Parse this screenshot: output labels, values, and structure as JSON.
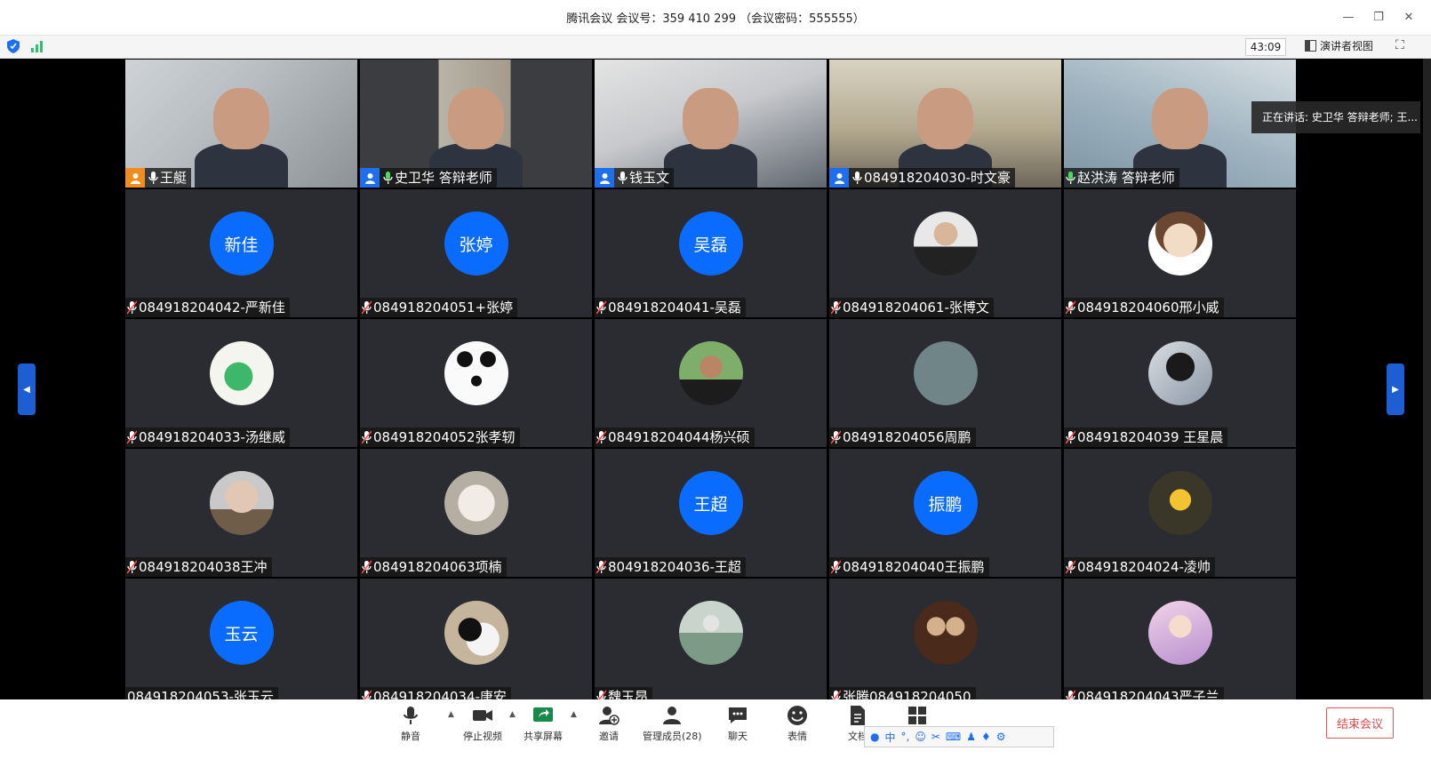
{
  "window": {
    "title": "腾讯会议 会议号：359 410 299 （会议密码：555555）",
    "controls": [
      "—",
      "❐",
      "✕"
    ]
  },
  "status": {
    "timer": "43:09",
    "presenter_view": "演讲者视图"
  },
  "speaking_tooltip": "正在讲话: 史卫华 答辩老师; 王...",
  "tiles": [
    {
      "name": "王艇",
      "kind": "video",
      "scene": "s1",
      "icon": "orange",
      "mic": "on"
    },
    {
      "name": "史卫华 答辩老师",
      "kind": "video",
      "scene": "s2",
      "icon": "blue",
      "mic": "speaking",
      "active": true
    },
    {
      "name": "钱玉文",
      "kind": "video",
      "scene": "s3",
      "icon": "blue",
      "mic": "on"
    },
    {
      "name": "084918204030-时文豪",
      "kind": "video",
      "scene": "s4",
      "icon": "blue",
      "mic": "on"
    },
    {
      "name": "赵洪涛 答辩老师",
      "kind": "video",
      "scene": "s5",
      "icon": "none",
      "mic": "speaking"
    },
    {
      "name": "084918204042-严新佳",
      "kind": "avatar",
      "initials": "新佳",
      "mic": "muted"
    },
    {
      "name": "084918204051+张婷",
      "kind": "avatar",
      "initials": "张婷",
      "mic": "muted"
    },
    {
      "name": "084918204041-吴磊",
      "kind": "avatar",
      "initials": "吴磊",
      "mic": "muted"
    },
    {
      "name": "084918204061-张博文",
      "kind": "photo",
      "photo": "p1",
      "mic": "muted"
    },
    {
      "name": "084918204060邢小威",
      "kind": "photo",
      "photo": "p2",
      "mic": "muted"
    },
    {
      "name": "084918204033-汤继威",
      "kind": "photo",
      "photo": "p3",
      "mic": "muted"
    },
    {
      "name": "084918204052张孝轫",
      "kind": "photo",
      "photo": "p4",
      "mic": "muted"
    },
    {
      "name": "084918204044杨兴硕",
      "kind": "photo",
      "photo": "p5",
      "mic": "muted"
    },
    {
      "name": "084918204056周鹏",
      "kind": "photo",
      "photo": "p6",
      "mic": "muted"
    },
    {
      "name": "084918204039 王星晨",
      "kind": "photo",
      "photo": "p7",
      "mic": "muted"
    },
    {
      "name": "084918204038王冲",
      "kind": "photo",
      "photo": "p8",
      "mic": "muted"
    },
    {
      "name": "084918204063项楠",
      "kind": "photo",
      "photo": "p9",
      "mic": "muted"
    },
    {
      "name": "804918204036-王超",
      "kind": "avatar",
      "initials": "王超",
      "mic": "muted"
    },
    {
      "name": "084918204040王振鹏",
      "kind": "avatar",
      "initials": "振鹏",
      "mic": "muted"
    },
    {
      "name": "084918204024-凌帅",
      "kind": "photo",
      "photo": "p10",
      "mic": "muted"
    },
    {
      "name": "084918204053-张玉云",
      "kind": "avatar",
      "initials": "玉云",
      "mic": "none"
    },
    {
      "name": "084918204034-唐安",
      "kind": "photo",
      "photo": "p11",
      "mic": "muted"
    },
    {
      "name": "魏玉昂",
      "kind": "photo",
      "photo": "p12",
      "mic": "muted"
    },
    {
      "name": "张腾084918204050",
      "kind": "photo",
      "photo": "p13",
      "mic": "muted"
    },
    {
      "name": "084918204043严子兰",
      "kind": "photo",
      "photo": "p14",
      "mic": "muted"
    }
  ],
  "toolbar": {
    "mute": "静音",
    "stop_video": "停止视频",
    "share_screen": "共享屏幕",
    "invite": "邀请",
    "manage_members": "管理成员(28)",
    "chat": "聊天",
    "reactions": "表情",
    "docs": "文档",
    "end_meeting": "结束会议"
  },
  "ime": {
    "lang": "中"
  },
  "colors": {
    "accent": "#0a6cff",
    "end_red": "#e04848",
    "tile_bg": "#2a2c31"
  }
}
